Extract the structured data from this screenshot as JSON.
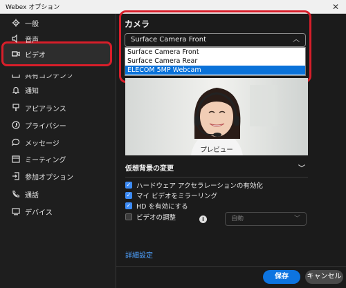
{
  "window": {
    "title": "Webex オプション",
    "close_glyph": "✕"
  },
  "sidebar": {
    "items": [
      {
        "label": "一般",
        "icon": "gear-icon"
      },
      {
        "label": "音声",
        "icon": "speaker-icon"
      },
      {
        "label": "ビデオ",
        "icon": "video-icon",
        "active": true
      },
      {
        "label": "共有コンテンツ",
        "icon": "share-icon"
      },
      {
        "label": "通知",
        "icon": "bell-icon"
      },
      {
        "label": "アピアランス",
        "icon": "paint-icon"
      },
      {
        "label": "プライバシー",
        "icon": "privacy-icon"
      },
      {
        "label": "メッセージ",
        "icon": "message-icon"
      },
      {
        "label": "ミーティング",
        "icon": "calendar-icon"
      },
      {
        "label": "参加オプション",
        "icon": "join-icon"
      },
      {
        "label": "通話",
        "icon": "phone-icon"
      },
      {
        "label": "デバイス",
        "icon": "device-icon"
      }
    ]
  },
  "camera": {
    "heading": "カメラ",
    "selected": "Surface Camera Front",
    "options": [
      "Surface Camera Front",
      "Surface Camera Rear",
      "ELECOM 5MP Webcam"
    ],
    "highlighted_index": 2
  },
  "preview": {
    "label": "プレビュー"
  },
  "virtual_background": {
    "label": "仮想背景の変更"
  },
  "options": [
    {
      "label": "ハードウェア アクセラレーションの有効化",
      "checked": true
    },
    {
      "label": "マイ ビデオをミラーリング",
      "checked": true
    },
    {
      "label": "HD を有効にする",
      "checked": true
    },
    {
      "label": "ビデオの調整",
      "checked": false
    }
  ],
  "adjust": {
    "value": "自動"
  },
  "advanced_link": "詳細設定",
  "buttons": {
    "save": "保存",
    "cancel": "キャンセル"
  },
  "colors": {
    "accent": "#0d74e0",
    "highlight": "#d81e2a",
    "link": "#4ea1ff"
  }
}
